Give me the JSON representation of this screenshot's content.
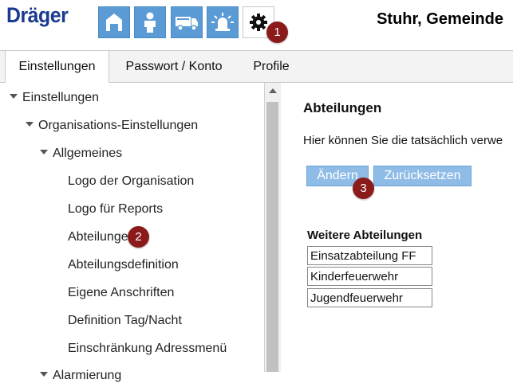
{
  "header": {
    "logo": "Dräger",
    "org_title": "Stuhr, Gemeinde",
    "nav_icons": [
      "home-icon",
      "person-icon",
      "truck-icon",
      "alarm-light-icon",
      "gear-icon"
    ]
  },
  "tabs": [
    {
      "label": "Einstellungen",
      "active": true
    },
    {
      "label": "Passwort / Konto",
      "active": false
    },
    {
      "label": "Profile",
      "active": false
    }
  ],
  "tree": {
    "root": "Einstellungen",
    "org": "Organisations-Einstellungen",
    "general": "Allgemeines",
    "items": [
      "Logo der Organisation",
      "Logo für Reports",
      "Abteilungen",
      "Abteilungsdefinition",
      "Eigene Anschriften",
      "Definition Tag/Nacht",
      "Einschränkung Adressmenü"
    ],
    "partial": "Alarmierung"
  },
  "content": {
    "title": "Abteilungen",
    "description": "Hier können Sie die tatsächlich verwe",
    "buttons": {
      "change": "Ändern",
      "reset": "Zurücksetzen"
    },
    "table_header": "Weitere Abteilungen",
    "rows": [
      "Einsatzabteilung FF",
      "Kinderfeuerwehr",
      "Jugendfeuerwehr"
    ]
  },
  "badges": [
    "1",
    "2",
    "3"
  ],
  "colors": {
    "accent": "#5b9bd5",
    "button": "#8fbce6",
    "badge": "#8b1a1a",
    "logo": "#1a3a8f"
  }
}
